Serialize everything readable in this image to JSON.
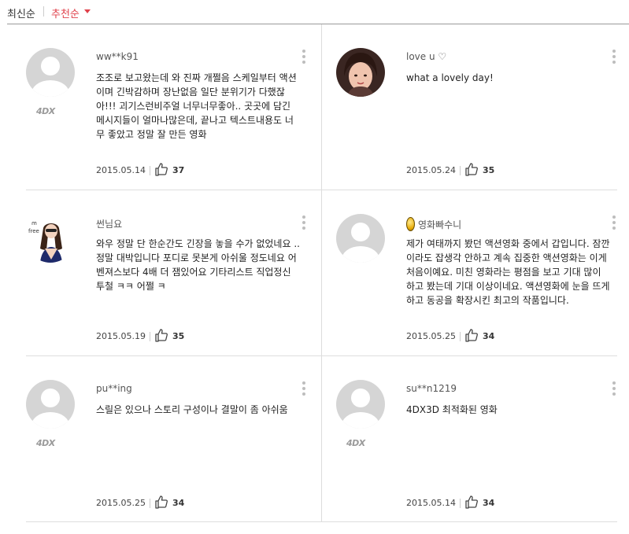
{
  "sort": {
    "latest": "최신순",
    "recommend": "추천순"
  },
  "badge_4dx": "4DX",
  "reviews": [
    {
      "user": "ww**k91",
      "text": "조조로 보고왔는데 와 진짜 개쩔음 스케일부터 액션이며 긴박감하며 장난없음 일단 분위기가 다했잖아!!! 괴기스런비주얼 너무너무좋아.. 곳곳에 담긴 메시지들이 얼마나많은데, 끝나고 텍스트내용도 너무 좋았고 정말 잘 만든 영화",
      "date": "2015.05.14",
      "likes": "37"
    },
    {
      "user": "love u ♡",
      "text": "what a lovely day!",
      "date": "2015.05.24",
      "likes": "35"
    },
    {
      "user": "썬님요",
      "text": "와우 정말 단 한순간도 긴장을 놓을 수가 없었네요 .. 정말 대박입니다 포디로 못본게 아쉬울 정도네요 어벤져스보다 4배 더 잼있어요 기타리스트 직업정신 투철 ㅋㅋ 어쩔 ㅋ",
      "date": "2015.05.19",
      "likes": "35"
    },
    {
      "user": "영화빠수니",
      "text": "제가 여태까지 봤던 액션영화 중에서 갑입니다. 잠깐이라도 잡생각 안하고 계속 집중한 액션영화는 이게 처음이예요. 미친 영화라는 평점을 보고 기대 많이 하고 봤는데 기대 이상이네요. 액션영화에 눈을 뜨게 하고 동공을 확장시킨 최고의 작품입니다.",
      "date": "2015.05.25",
      "likes": "34"
    },
    {
      "user": "pu**ing",
      "text": "스릴은 있으나 스토리 구성이나 결말이 좀 아쉬움",
      "date": "2015.05.25",
      "likes": "34"
    },
    {
      "user": "su**n1219",
      "text": "4DX3D 최적화된 영화",
      "date": "2015.05.14",
      "likes": "34"
    }
  ]
}
